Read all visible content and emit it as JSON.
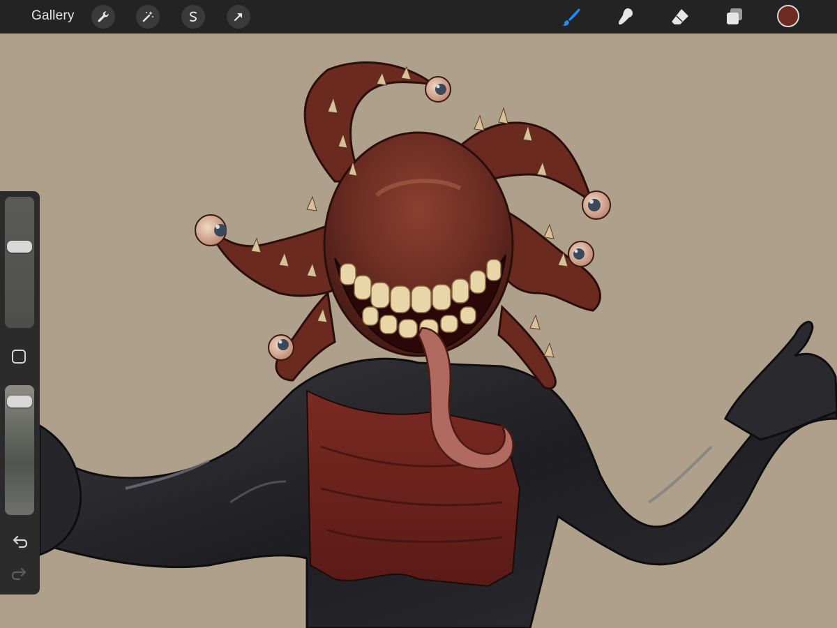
{
  "app": {
    "gallery_label": "Gallery"
  },
  "toolbar": {
    "left_tools": [
      {
        "name": "actions",
        "icon": "wrench-icon"
      },
      {
        "name": "adjustments",
        "icon": "magic-wand-icon"
      },
      {
        "name": "selection",
        "icon": "selection-s-icon"
      },
      {
        "name": "transform",
        "icon": "arrow-cursor-icon"
      }
    ],
    "right_tools": [
      {
        "name": "brush",
        "icon": "brush-icon",
        "active": true
      },
      {
        "name": "smudge",
        "icon": "smudge-finger-icon",
        "active": false
      },
      {
        "name": "eraser",
        "icon": "eraser-icon",
        "active": false
      },
      {
        "name": "layers",
        "icon": "layers-icon",
        "active": false
      }
    ],
    "current_color": "#6d2a22",
    "active_tool_color": "#1e8bf2"
  },
  "sidebar": {
    "brush_size_level": 0.64,
    "opacity_level": 0.93,
    "modify_button_icon": "square-icon",
    "undo_icon": "undo-icon",
    "redo_icon": "redo-icon",
    "redo_enabled": false
  },
  "canvas": {
    "background_color": "#aea08a",
    "artwork": "octopus-headed-figure-illustration"
  }
}
